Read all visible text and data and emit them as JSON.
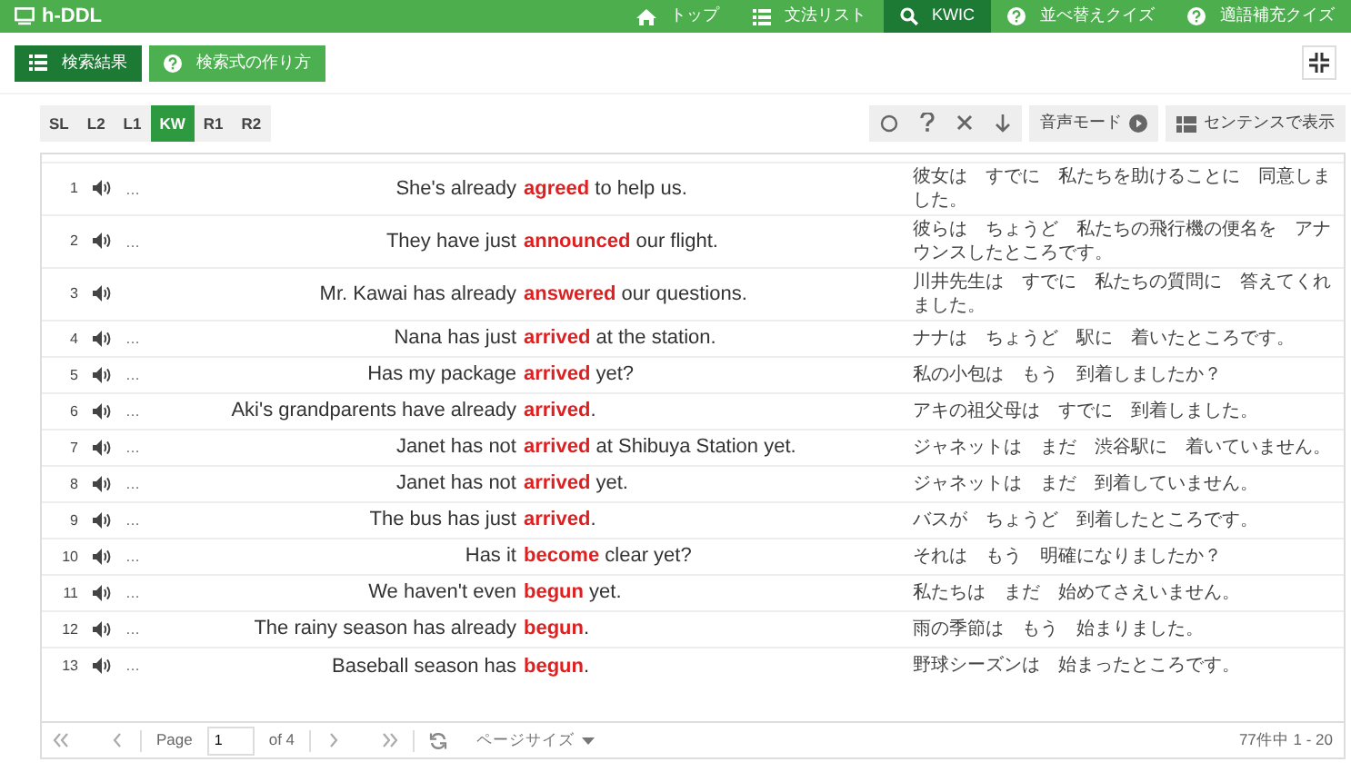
{
  "app_title": "h-DDL",
  "nav": [
    {
      "label": "トップ",
      "selected": false
    },
    {
      "label": "文法リスト",
      "selected": false
    },
    {
      "label": "KWIC",
      "selected": true
    },
    {
      "label": "並べ替えクイズ",
      "selected": false
    },
    {
      "label": "適語補充クイズ",
      "selected": false
    }
  ],
  "view_buttons": [
    {
      "label": "検索結果",
      "selected": true
    },
    {
      "label": "検索式の作り方",
      "selected": false
    }
  ],
  "sort_tabs": [
    {
      "label": "SL",
      "selected": false
    },
    {
      "label": "L2",
      "selected": false
    },
    {
      "label": "L1",
      "selected": false
    },
    {
      "label": "KW",
      "selected": true
    },
    {
      "label": "R1",
      "selected": false
    },
    {
      "label": "R2",
      "selected": false
    }
  ],
  "tools": [
    {
      "label": "音声モード"
    },
    {
      "label": "センテンスで表示"
    }
  ],
  "rows": [
    {
      "num": "1",
      "note": "…",
      "left": "She's already",
      "keyword": "agreed",
      "right": "to help us.",
      "translation": "彼女は　すでに　私たちを助けることに　同意しました。"
    },
    {
      "num": "2",
      "note": "…",
      "left": "They have just",
      "keyword": "announced",
      "right": "our flight.",
      "translation": "彼らは　ちょうど　私たちの飛行機の便名を　アナウンスしたところです。"
    },
    {
      "num": "3",
      "left": "Mr. Kawai has already",
      "keyword": "answered",
      "right": "our questions.",
      "translation": "川井先生は　すでに　私たちの質問に　答えてくれました。"
    },
    {
      "num": "4",
      "note": "…",
      "left": "Nana has just",
      "keyword": "arrived",
      "right": "at the station.",
      "translation": "ナナは　ちょうど　駅に　着いたところです。"
    },
    {
      "num": "5",
      "note": "…",
      "left": "Has my package",
      "keyword": "arrived",
      "right": "yet?",
      "translation": "私の小包は　もう　到着しましたか？"
    },
    {
      "num": "6",
      "note": "…",
      "left": "Aki's grandparents have already",
      "keyword": "arrived",
      "right": ".",
      "translation": "アキの祖父母は　すでに　到着しました。"
    },
    {
      "num": "7",
      "note": "…",
      "left": "Janet has not",
      "keyword": "arrived",
      "right": "at Shibuya Station yet.",
      "translation": "ジャネットは　まだ　渋谷駅に　着いていません。"
    },
    {
      "num": "8",
      "note": "…",
      "left": "Janet has not",
      "keyword": "arrived",
      "right": "yet.",
      "translation": "ジャネットは　まだ　到着していません。"
    },
    {
      "num": "9",
      "note": "…",
      "left": "The bus has just",
      "keyword": "arrived",
      "right": ".",
      "translation": "バスが　ちょうど　到着したところです。"
    },
    {
      "num": "10",
      "note": "…",
      "left": "Has it",
      "keyword": "become",
      "right": "clear yet?",
      "translation": "それは　もう　明確になりましたか？"
    },
    {
      "num": "11",
      "note": "…",
      "left": "We haven't even",
      "keyword": "begun",
      "right": "yet.",
      "translation": "私たちは　まだ　始めてさえいません。"
    },
    {
      "num": "12",
      "note": "…",
      "left": "The rainy season has already",
      "keyword": "begun",
      "right": ".",
      "translation": "雨の季節は　もう　始まりました。"
    },
    {
      "num": "13",
      "note": "…",
      "left": "Baseball season has",
      "keyword": "begun",
      "right": ".",
      "translation": "野球シーズンは　始まったところです。"
    }
  ],
  "pager": {
    "page_label": "Page",
    "page": "1",
    "of": "of 4",
    "page_size": "ページサイズ",
    "summary": "77件中 1 - 20"
  }
}
